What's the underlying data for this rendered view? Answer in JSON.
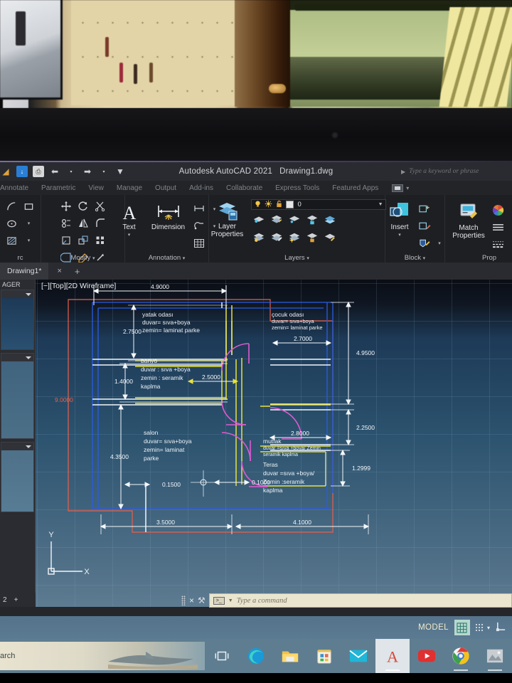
{
  "app": {
    "title": "Autodesk AutoCAD 2021",
    "document": "Drawing1.dwg",
    "search_placeholder": "Type a keyword or phrase"
  },
  "quick_access": [
    {
      "name": "save-icon",
      "glyph": "↓"
    },
    {
      "name": "save-as-icon",
      "glyph": "⇩"
    },
    {
      "name": "print-icon",
      "glyph": "⎙"
    },
    {
      "name": "undo-icon",
      "glyph": "←"
    },
    {
      "name": "redo-icon",
      "glyph": "→"
    },
    {
      "name": "customize-icon",
      "glyph": "▾"
    }
  ],
  "ribbon": {
    "tabs": [
      "Annotate",
      "Parametric",
      "View",
      "Manage",
      "Output",
      "Add-ins",
      "Collaborate",
      "Express Tools",
      "Featured Apps"
    ],
    "panels": [
      {
        "name": "draw",
        "title": "",
        "label": "rc"
      },
      {
        "name": "modify",
        "title": "Modify"
      },
      {
        "name": "annotation",
        "title": "Annotation",
        "text_label": "Text",
        "dimension_label": "Dimension"
      },
      {
        "name": "layers",
        "title": "Layers",
        "layer_properties_label": "Layer\nProperties",
        "current_layer": "0"
      },
      {
        "name": "block",
        "title": "Block",
        "insert_label": "Insert"
      },
      {
        "name": "properties",
        "title": "Prop",
        "match_label": "Match\nProperties"
      }
    ]
  },
  "file_tabs": {
    "active": "Drawing1*",
    "close_glyph": "×",
    "new_glyph": "+"
  },
  "left_panel": {
    "header": "AGER",
    "sections": 3,
    "bottom_label": "2",
    "bottom_plus": "+"
  },
  "viewport": {
    "label": "[−][Top][2D Wireframe]",
    "ucs_x": "X",
    "ucs_y": "Y"
  },
  "drawing": {
    "rooms": [
      {
        "name": "yatak-odasi",
        "lines": [
          "yatak odası",
          "duvar= sıva+boya",
          "zemin= laminat parke"
        ]
      },
      {
        "name": "cocuk-odasi",
        "lines": [
          "çocuk odası",
          "duvar= sıva+boya",
          "zemin= laminat parke"
        ]
      },
      {
        "name": "banyo",
        "lines": [
          "banyo",
          "duvar : sıva +boya",
          "zemin : seramik",
          "kaplma"
        ]
      },
      {
        "name": "salon",
        "lines": [
          "salon",
          "duvar= sıva+boya",
          "zemin= laminat",
          "parke"
        ]
      },
      {
        "name": "mutfak",
        "lines": [
          "mutfak",
          "duvar =sıva +boya/ Zemin",
          "seramik kaplma"
        ]
      },
      {
        "name": "teras",
        "lines": [
          "Teras",
          "duvar =sıva +boya/",
          "Zemin :seramik",
          "kaplma"
        ]
      }
    ],
    "dimensions": {
      "top": "4.9000",
      "left_upper": "2.7500",
      "left_mid": "1.4000",
      "left_lower": "4.3500",
      "left_total": "9.0000",
      "right_upper": "4.9500",
      "right_mid": "2.2500",
      "right_lower": "1.2999",
      "inner_cocuk": "2.7000",
      "inner_banyo": "2.5000",
      "inner_mutfak": "2.8000",
      "wall_left": "0.1500",
      "wall_mid": "0.1000",
      "bottom_left": "3.5000",
      "bottom_right": "4.1000"
    },
    "colors": {
      "wall_white": "#f2f6fa",
      "wall_yellow": "#e8e23c",
      "wall_blue": "#2b5ce0",
      "door_magenta": "#e05ad0",
      "outline_red": "#e8604a"
    }
  },
  "command_line": {
    "placeholder": "Type a command",
    "close_glyph": "×",
    "wrench_glyph": "⚒"
  },
  "status_bar": {
    "space": "MODEL",
    "grid_icon": "grid-icon",
    "snap_icon": "snap-icon",
    "ucs_icon": "ucs-icon",
    "caret": "▾"
  },
  "taskbar": {
    "search_text": "arch",
    "items": [
      {
        "name": "task-view",
        "label": "Task View"
      },
      {
        "name": "edge",
        "label": "Microsoft Edge"
      },
      {
        "name": "file-explorer",
        "label": "File Explorer"
      },
      {
        "name": "microsoft-store",
        "label": "Microsoft Store"
      },
      {
        "name": "mail",
        "label": "Mail"
      },
      {
        "name": "autocad",
        "label": "AutoCAD"
      },
      {
        "name": "youtube",
        "label": "YouTube"
      },
      {
        "name": "chrome",
        "label": "Google Chrome"
      },
      {
        "name": "photo-app",
        "label": "Photos"
      }
    ]
  }
}
